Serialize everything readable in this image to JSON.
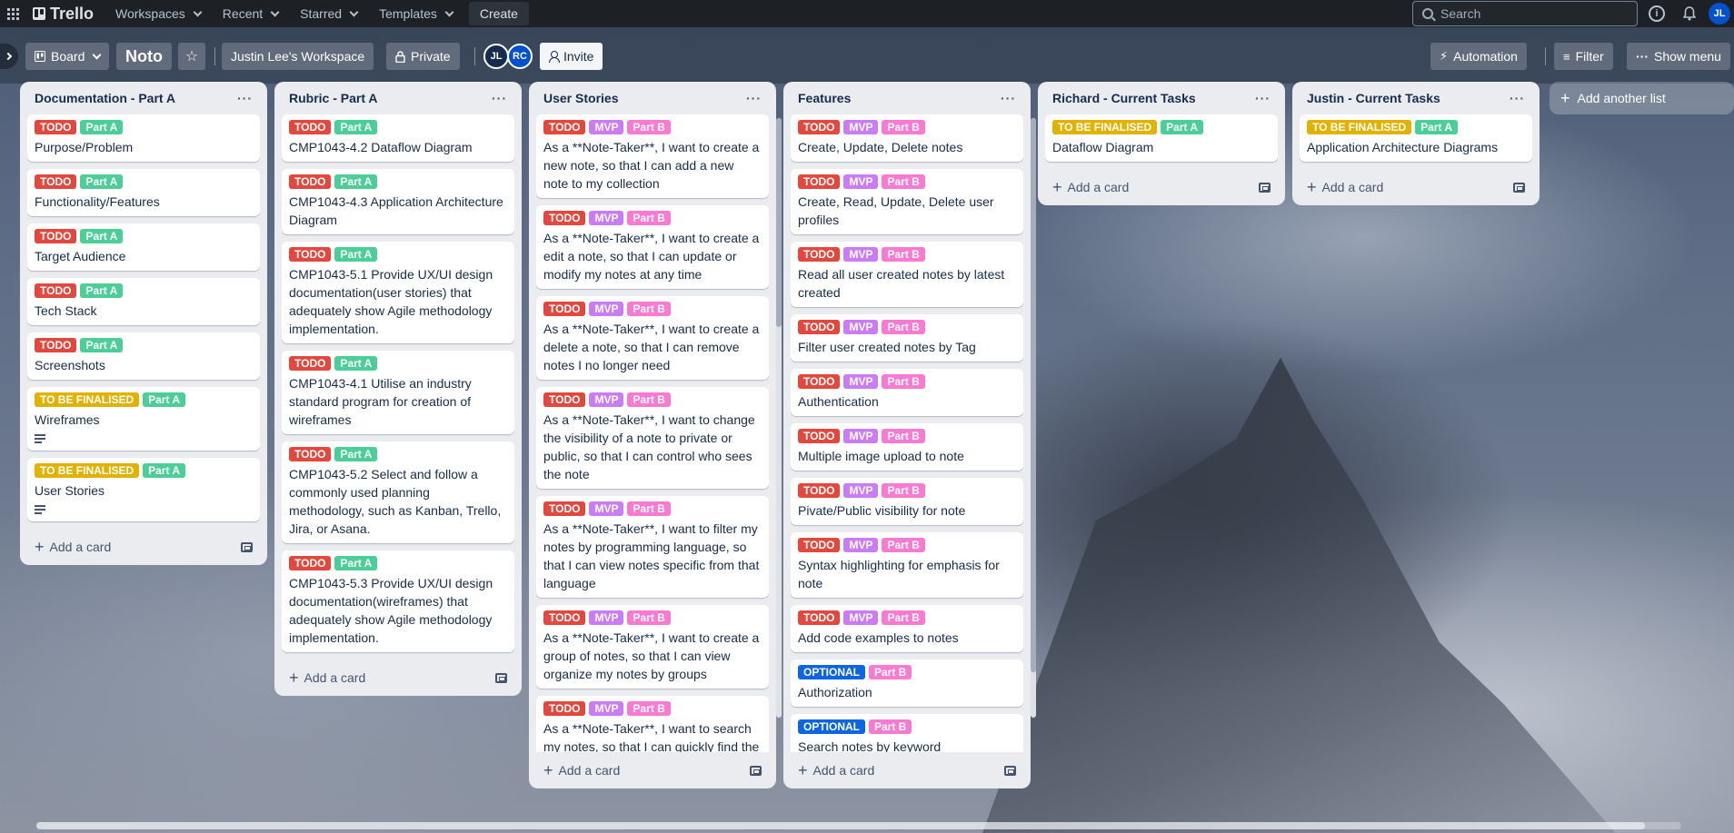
{
  "topnav": {
    "brand": "Trello",
    "workspaces": "Workspaces",
    "recent": "Recent",
    "starred": "Starred",
    "templates": "Templates",
    "create": "Create",
    "search_placeholder": "Search",
    "user_initials": "JL"
  },
  "board": {
    "view": "Board",
    "title": "Noto",
    "workspace": "Justin Lee's Workspace",
    "visibility": "Private",
    "members": [
      "JL",
      "RC"
    ],
    "invite": "Invite",
    "automation": "Automation",
    "filter": "Filter",
    "show_menu": "Show menu",
    "add_list": "Add another list",
    "add_card": "Add a card"
  },
  "label_colors": {
    "TODO": "#e2483d",
    "Part A": "#4bce97",
    "Part B": "#f87ad3",
    "MVP": "#c97cf4",
    "TO BE FINALISED": "#e2b203",
    "OPTIONAL": "#0c66e4"
  },
  "lists": [
    {
      "title": "Documentation - Part A",
      "cards": [
        {
          "labels": [
            "TODO",
            "Part A"
          ],
          "text": "Purpose/Problem"
        },
        {
          "labels": [
            "TODO",
            "Part A"
          ],
          "text": "Functionality/Features"
        },
        {
          "labels": [
            "TODO",
            "Part A"
          ],
          "text": "Target Audience"
        },
        {
          "labels": [
            "TODO",
            "Part A"
          ],
          "text": "Tech Stack"
        },
        {
          "labels": [
            "TODO",
            "Part A"
          ],
          "text": "Screenshots"
        },
        {
          "labels": [
            "TO BE FINALISED",
            "Part A"
          ],
          "text": "Wireframes",
          "desc": true
        },
        {
          "labels": [
            "TO BE FINALISED",
            "Part A"
          ],
          "text": "User Stories",
          "desc": true
        }
      ]
    },
    {
      "title": "Rubric - Part A",
      "cards": [
        {
          "labels": [
            "TODO",
            "Part A"
          ],
          "text": "CMP1043-4.2 Dataflow Diagram"
        },
        {
          "labels": [
            "TODO",
            "Part A"
          ],
          "text": "CMP1043-4.3 Application Architecture Diagram"
        },
        {
          "labels": [
            "TODO",
            "Part A"
          ],
          "text": "CMP1043-5.1 Provide UX/UI design documentation(user stories) that adequately show Agile methodology implementation."
        },
        {
          "labels": [
            "TODO",
            "Part A"
          ],
          "text": "CMP1043-4.1 Utilise an industry standard program for creation of wireframes"
        },
        {
          "labels": [
            "TODO",
            "Part A"
          ],
          "text": "CMP1043-5.2 Select and follow a commonly used planning methodology, such as Kanban, Trello, Jira, or Asana."
        },
        {
          "labels": [
            "TODO",
            "Part A"
          ],
          "text": "CMP1043-5.3 Provide UX/UI design documentation(wireframes) that adequately show Agile methodology implementation."
        }
      ]
    },
    {
      "title": "User Stories",
      "cards": [
        {
          "labels": [
            "TODO",
            "MVP",
            "Part B"
          ],
          "text": "As a **Note-Taker**, I want to create a new note, so that I can add a new note to my collection"
        },
        {
          "labels": [
            "TODO",
            "MVP",
            "Part B"
          ],
          "text": "As a **Note-Taker**, I want to create a edit a note, so that I can update or modify my notes at any time"
        },
        {
          "labels": [
            "TODO",
            "MVP",
            "Part B"
          ],
          "text": "As a **Note-Taker**, I want to create a delete a note, so that I can remove notes I no longer need"
        },
        {
          "labels": [
            "TODO",
            "MVP",
            "Part B"
          ],
          "text": "As a **Note-Taker**, I want to change the visibility of a note to private or public, so that I can control who sees the note"
        },
        {
          "labels": [
            "TODO",
            "MVP",
            "Part B"
          ],
          "text": "As a **Note-Taker**, I want to filter my notes by programming language, so that I can view notes specific from that language"
        },
        {
          "labels": [
            "TODO",
            "MVP",
            "Part B"
          ],
          "text": "As a **Note-Taker**, I want to create a group of notes, so that I can view organize my notes by groups"
        },
        {
          "labels": [
            "TODO",
            "MVP",
            "Part B"
          ],
          "text": "As a **Note-Taker**, I want to search my notes, so that I can quickly find the right note using keywords"
        }
      ]
    },
    {
      "title": "Features",
      "cards": [
        {
          "labels": [
            "TODO",
            "MVP",
            "Part B"
          ],
          "text": "Create, Update, Delete notes"
        },
        {
          "labels": [
            "TODO",
            "MVP",
            "Part B"
          ],
          "text": "Create, Read, Update, Delete user profiles"
        },
        {
          "labels": [
            "TODO",
            "MVP",
            "Part B"
          ],
          "text": "Read all user created notes by latest created"
        },
        {
          "labels": [
            "TODO",
            "MVP",
            "Part B"
          ],
          "text": "Filter user created notes by Tag"
        },
        {
          "labels": [
            "TODO",
            "MVP",
            "Part B"
          ],
          "text": "Authentication"
        },
        {
          "labels": [
            "TODO",
            "MVP",
            "Part B"
          ],
          "text": "Multiple image upload to note"
        },
        {
          "labels": [
            "TODO",
            "MVP",
            "Part B"
          ],
          "text": "Pivate/Public visibility for note"
        },
        {
          "labels": [
            "TODO",
            "MVP",
            "Part B"
          ],
          "text": "Syntax highlighting for emphasis for note"
        },
        {
          "labels": [
            "TODO",
            "MVP",
            "Part B"
          ],
          "text": "Add code examples to notes"
        },
        {
          "labels": [
            "OPTIONAL",
            "Part B"
          ],
          "text": "Authorization"
        },
        {
          "labels": [
            "OPTIONAL",
            "Part B"
          ],
          "text": "Search notes by keyword"
        }
      ]
    },
    {
      "title": "Richard - Current Tasks",
      "cards": [
        {
          "labels": [
            "TO BE FINALISED",
            "Part A"
          ],
          "text": "Dataflow Diagram"
        }
      ]
    },
    {
      "title": "Justin - Current Tasks",
      "cards": [
        {
          "labels": [
            "TO BE FINALISED",
            "Part A"
          ],
          "text": "Application Architecture Diagrams"
        }
      ]
    }
  ]
}
